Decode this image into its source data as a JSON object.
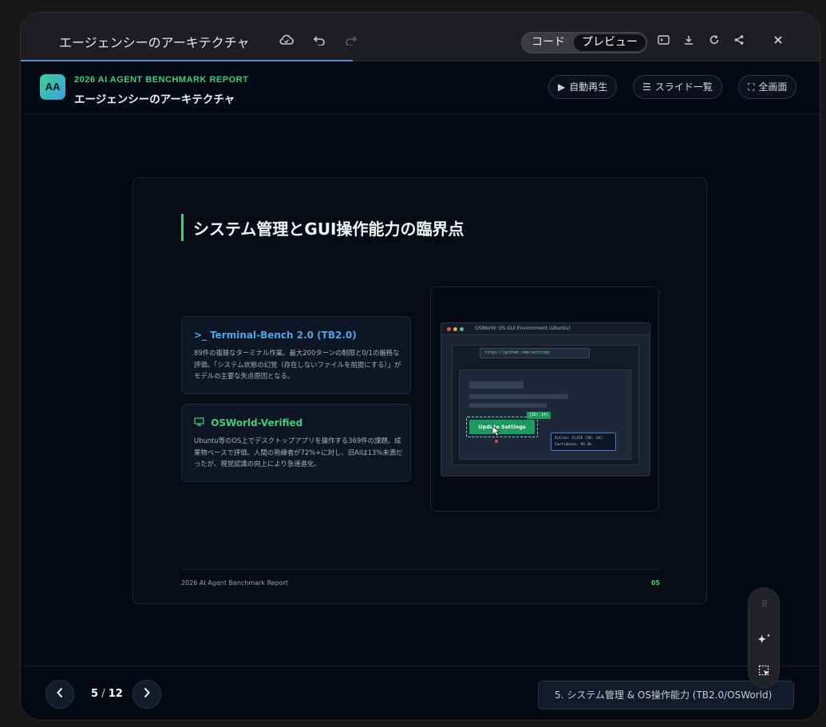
{
  "topbar": {
    "title": "エージェンシーのアーキテクチャ",
    "tabs": [
      {
        "label": "コード"
      },
      {
        "label": "プレビュー"
      }
    ],
    "icons": [
      "cloud-icon",
      "undo-icon",
      "redo-icon",
      "terminal-icon",
      "download-icon",
      "refresh-icon",
      "share-icon",
      "close-icon"
    ]
  },
  "header": {
    "logo": "AA",
    "report": "2026 AI AGENT BENCHMARK REPORT",
    "title": "エージェンシーのアーキテクチャ",
    "buttons": {
      "autoplay": "自動再生",
      "slides": "スライド一覧",
      "fullscreen": "全画面"
    }
  },
  "slide": {
    "title": "システム管理とGUI操作能力の臨界点",
    "cards": [
      {
        "title": "Terminal-Bench 2.0 (TB2.0)",
        "body": "89件の複雑なターミナル作業。最大200ターンの制限と0/1の厳格な評価。「システム状態の幻覚（存在しないファイルを前提にする）」がモデルの主要な失点原因となる。",
        "color": "#4aa8e8"
      },
      {
        "title": "OSWorld-Verified",
        "body": "Ubuntu等のOS上でデスクトップアプリを操作する369件の課題。成果物ベースで評価。人間の熟練者が72%+に対し、旧AIは13%未満だったが、視覚認識の向上により急速進化。",
        "color": "#3ecf7c"
      }
    ],
    "screenshot": {
      "window_title": "OSWorld: OS GUI Environment (Ubuntu)",
      "url": "https://github.com/settings",
      "button": "Update Settings",
      "tag": "[ID: 14]",
      "action_line1": "Action: CLICK [ID: 14]",
      "action_line2": "Confidence: 94.2%"
    },
    "footer_left": "2026 AI Agent Benchmark Report",
    "footer_right": "05"
  },
  "footer": {
    "current": "5",
    "total": "12",
    "separator": "/",
    "chapter": "5. システム管理 & OS操作能力 (TB2.0/OSWorld)"
  },
  "colors": {
    "accent_green": "#3ecf7c",
    "accent_blue": "#4c8fd8",
    "background": "#050913"
  }
}
